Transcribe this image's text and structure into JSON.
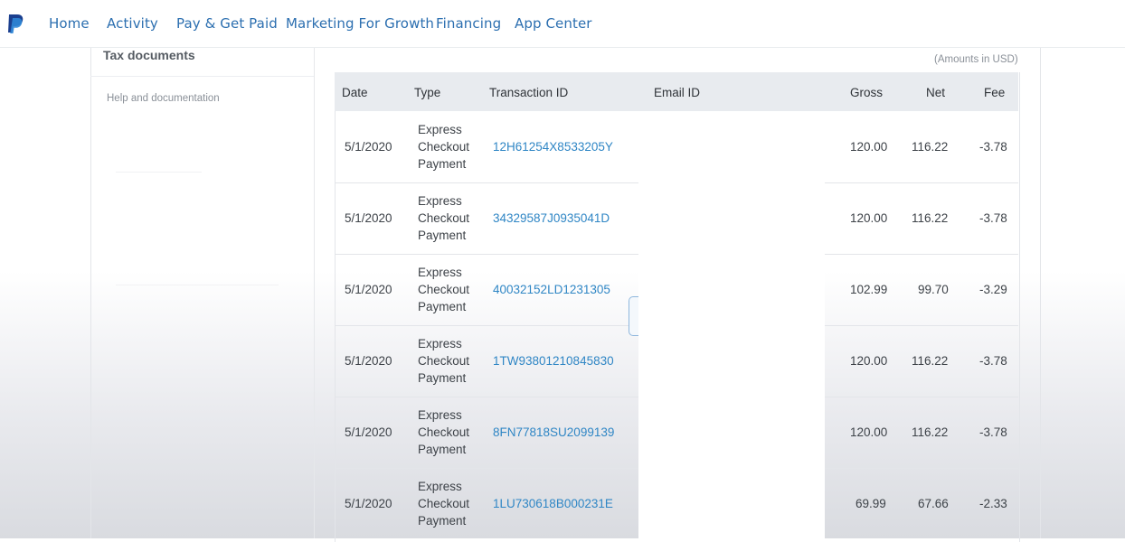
{
  "nav": {
    "items": [
      "Home",
      "Activity",
      "Pay & Get Paid",
      "Marketing For Growth",
      "Financing",
      "App Center"
    ],
    "brand_color": "#2c6fb0"
  },
  "sidebar": {
    "title": "Tax documents",
    "help": "Help and documentation"
  },
  "table": {
    "note": "(Amounts in USD)",
    "headers": [
      "Date",
      "Type",
      "Transaction ID",
      "Email ID",
      "Gross",
      "Net",
      "Fee"
    ],
    "link_color": "#2f86c5",
    "rows": [
      {
        "date": "5/1/2020",
        "type": [
          "Express",
          "Checkout",
          "Payment"
        ],
        "txid": "12H61254X8533205Y",
        "gross": "120.00",
        "net": "116.22",
        "fee": "-3.78"
      },
      {
        "date": "5/1/2020",
        "type": [
          "Express",
          "Checkout",
          "Payment"
        ],
        "txid": "34329587J0935041D",
        "gross": "120.00",
        "net": "116.22",
        "fee": "-3.78"
      },
      {
        "date": "5/1/2020",
        "type": [
          "Express",
          "Checkout",
          "Payment"
        ],
        "txid": "40032152LD1231305",
        "gross": "102.99",
        "net": "99.70",
        "fee": "-3.29"
      },
      {
        "date": "5/1/2020",
        "type": [
          "Express",
          "Checkout",
          "Payment"
        ],
        "txid": "1TW93801210845830",
        "gross": "120.00",
        "net": "116.22",
        "fee": "-3.78"
      },
      {
        "date": "5/1/2020",
        "type": [
          "Express",
          "Checkout",
          "Payment"
        ],
        "txid": "8FN77818SU2099139",
        "gross": "120.00",
        "net": "116.22",
        "fee": "-3.78"
      },
      {
        "date": "5/1/2020",
        "type": [
          "Express",
          "Checkout",
          "Payment"
        ],
        "txid": "1LU730618B000231E",
        "gross": "69.99",
        "net": "67.66",
        "fee": "-2.33"
      }
    ]
  }
}
